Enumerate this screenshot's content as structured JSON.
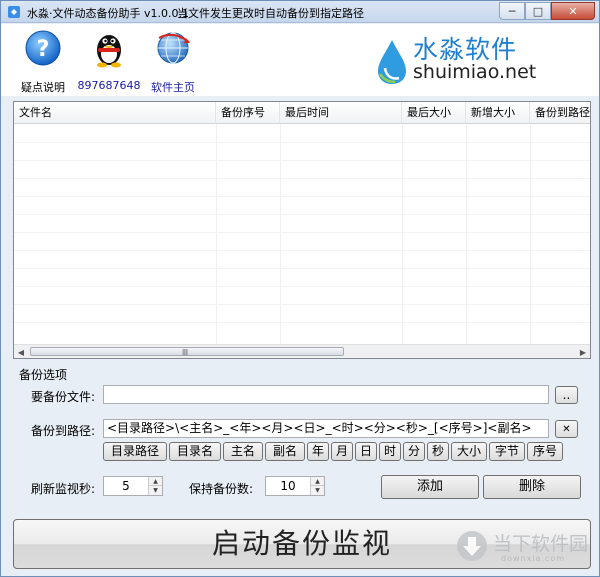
{
  "window": {
    "title": "水淼·文件动态备份助手 v1.0.0.1",
    "subtitle": "当文件发生更改时自动备份到指定路径",
    "controls": {
      "minimize": "─",
      "maximize": "□",
      "close": "✕"
    }
  },
  "toolbar": {
    "help_label": "疑点说明",
    "qq_label": "897687648",
    "home_label": "软件主页"
  },
  "logo": {
    "cn": "水淼软件",
    "en": "shuimiao.net"
  },
  "list": {
    "columns": [
      "文件名",
      "备份序号",
      "最后时间",
      "最后大小",
      "新增大小",
      "备份到路径"
    ],
    "grip": "|||||"
  },
  "options": {
    "section_title": "备份选项",
    "file_label": "要备份文件:",
    "file_value": "",
    "browse_label": "..",
    "path_label": "备份到路径:",
    "path_value": "<目录路径>\\<主名>_<年><月><日>_<时><分><秒>_[<序号>]<副名>",
    "clear_label": "✕",
    "tokens": [
      "目录路径",
      "目录名",
      "主名",
      "副名",
      "年",
      "月",
      "日",
      "时",
      "分",
      "秒",
      "大小",
      "字节",
      "序号"
    ],
    "refresh_label": "刷新监视秒:",
    "refresh_value": "5",
    "keep_label": "保持备份数:",
    "keep_value": "10",
    "add_label": "添加",
    "delete_label": "删除"
  },
  "start_button": "启动备份监视",
  "watermark": {
    "text": "当下软件园",
    "sub": "downxia.com"
  }
}
